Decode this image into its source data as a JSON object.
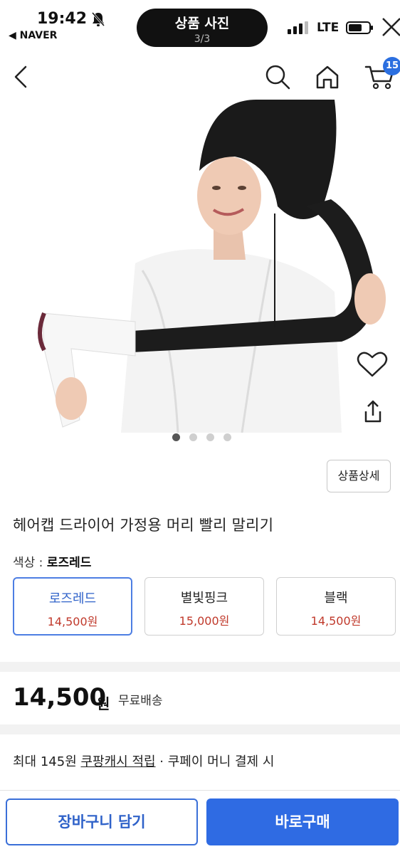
{
  "status_bar": {
    "time": "19:42",
    "back_app": "◀ NAVER",
    "network": "LTE"
  },
  "island": {
    "title": "상품 사진",
    "counter": "3/3"
  },
  "header": {
    "cart_count": "15"
  },
  "gallery": {
    "image_count": 4,
    "active_index": 0
  },
  "detail_button": "상품상세",
  "product": {
    "title": "헤어캡 드라이어 가정용 머리 빨리 말리기",
    "color_label": "색상 : ",
    "color_selected": "로즈레드"
  },
  "options": [
    {
      "name": "로즈레드",
      "price": "14,500원"
    },
    {
      "name": "별빛핑크",
      "price": "15,000원"
    },
    {
      "name": "블랙",
      "price": "14,500원"
    }
  ],
  "price": {
    "amount": "14,500",
    "unit": "원",
    "shipping": "무료배송"
  },
  "cash": {
    "prefix": "최대 145원 ",
    "link": "쿠팡캐시 적립",
    "suffix": " · 쿠페이 머니 결제 시"
  },
  "buttons": {
    "cart": "장바구니 담기",
    "buy": "바로구매"
  },
  "colors": {
    "accent": "#2f6be3",
    "price_red": "#c0392b"
  }
}
